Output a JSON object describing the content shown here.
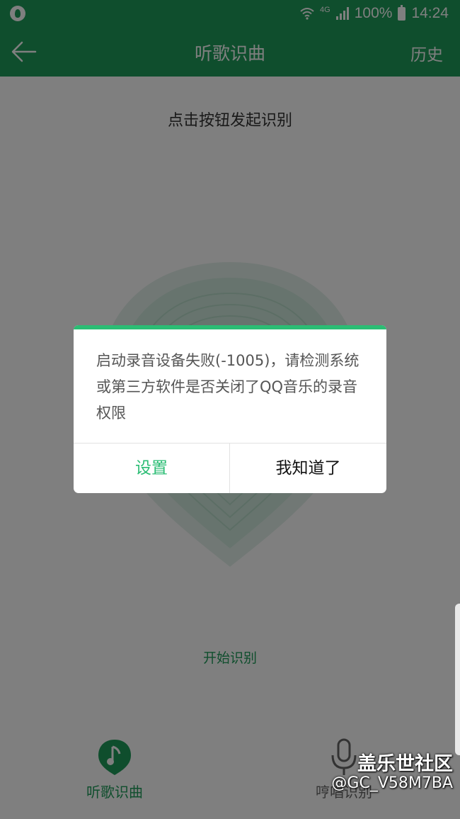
{
  "status_bar": {
    "network": "4G",
    "battery": "100%",
    "time": "14:24"
  },
  "app_bar": {
    "title": "听歌识曲",
    "history_label": "历史"
  },
  "main": {
    "hint": "点击按钮发起识别",
    "start_label": "开始识别"
  },
  "tabs": [
    {
      "label": "听歌识曲",
      "icon": "music-note-icon",
      "active": true
    },
    {
      "label": "哼唱识别",
      "icon": "microphone-icon",
      "active": false
    }
  ],
  "dialog": {
    "message": "启动录音设备失败(-1005)，请检测系统或第三方软件是否关闭了QQ音乐的录音权限",
    "settings_label": "设置",
    "ok_label": "我知道了"
  },
  "watermark": {
    "line1": "盖乐世社区",
    "line2": "@GC_V58M7BA"
  },
  "colors": {
    "brand": "#1f9d5b",
    "accent": "#2bbd74"
  }
}
